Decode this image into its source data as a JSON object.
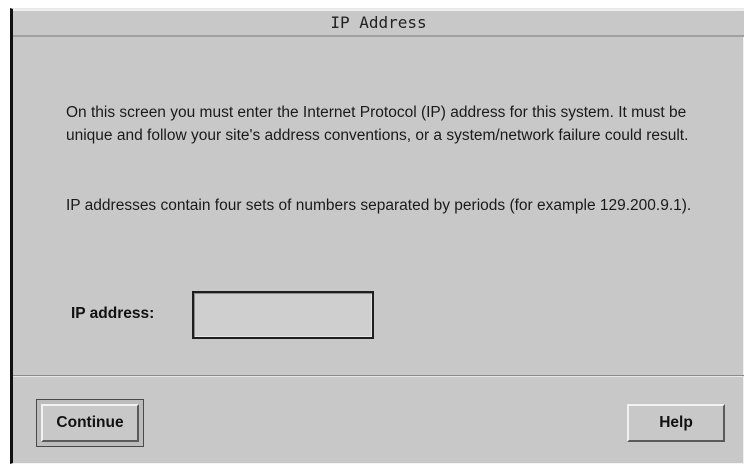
{
  "window": {
    "title": "IP Address"
  },
  "content": {
    "paragraph_1": "On this screen you must enter the Internet Protocol (IP) address for this system.  It must be unique and follow your site's address conventions, or a system/network failure could result.",
    "paragraph_2": "IP addresses contain four sets of numbers separated by periods (for example 129.200.9.1).",
    "ip_label": "IP address:",
    "ip_value": ""
  },
  "buttons": {
    "continue_label": "Continue",
    "help_label": "Help"
  },
  "colors": {
    "window_bg": "#c8c8c8",
    "text": "#1a1a1a"
  }
}
